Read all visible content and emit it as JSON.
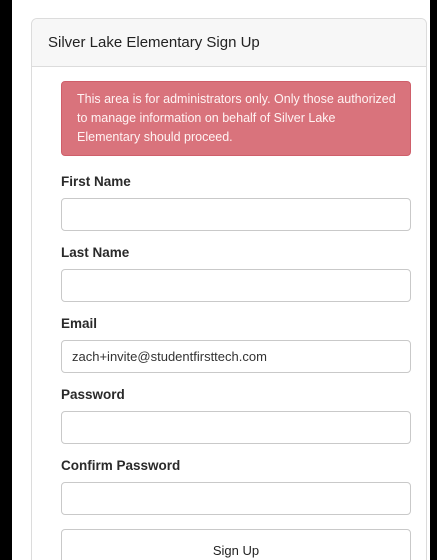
{
  "card": {
    "title": "Silver Lake Elementary Sign Up"
  },
  "alert": {
    "message": "This area is for administrators only. Only those authorized to manage information on behalf of Silver Lake Elementary should proceed."
  },
  "fields": {
    "first_name": {
      "label": "First Name",
      "value": ""
    },
    "last_name": {
      "label": "Last Name",
      "value": ""
    },
    "email": {
      "label": "Email",
      "value": "zach+invite@studentfirsttech.com"
    },
    "password": {
      "label": "Password",
      "value": ""
    },
    "confirm_password": {
      "label": "Confirm Password",
      "value": ""
    }
  },
  "submit": {
    "label": "Sign Up"
  },
  "colors": {
    "alert_background": "#d9737c",
    "page_background": "#000000"
  }
}
